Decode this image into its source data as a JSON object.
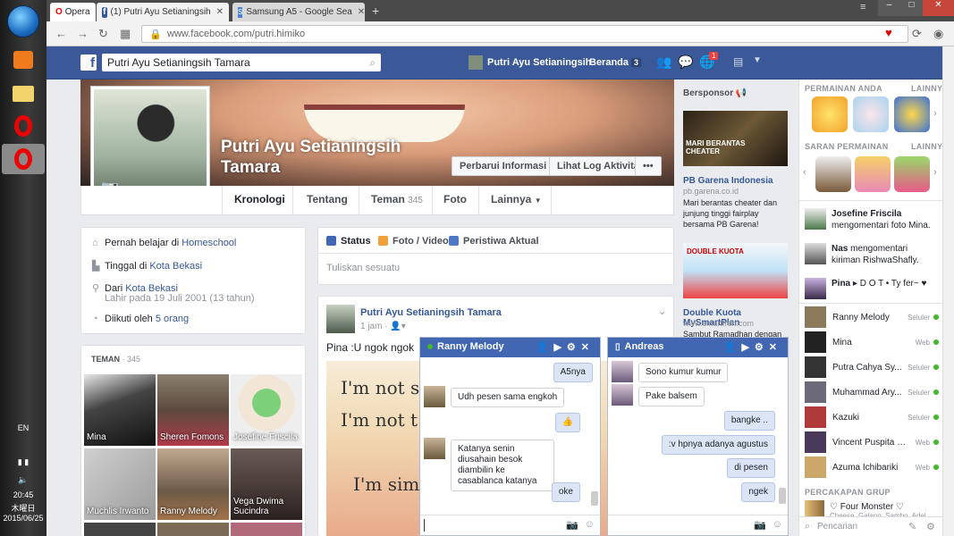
{
  "taskbar": {
    "lang": "EN",
    "time": "20:45",
    "day": "木曜日",
    "date": "2015/06/25"
  },
  "browser": {
    "opera_label": "Opera",
    "tabs": [
      {
        "label": "(1) Putri Ayu Setianingsih"
      },
      {
        "label": "Samsung A5 - Google Sea"
      }
    ],
    "url": "www.facebook.com/putri.himiko"
  },
  "fb_header": {
    "search_value": "Putri Ayu Setianingsih Tamara",
    "profile_name": "Putri Ayu Setianingsih",
    "home_label": "Beranda",
    "home_count": "3",
    "notif_count": "1"
  },
  "profile": {
    "name_line1": "Putri Ayu Setianingsih",
    "name_line2": "Tamara",
    "update_info": "Perbarui Informasi",
    "activity_log": "Lihat Log Aktivitas",
    "more": "•••",
    "tabs": {
      "timeline": "Kronologi",
      "about": "Tentang",
      "friends": "Teman",
      "friends_count": "345",
      "photos": "Foto",
      "more": "Lainnya"
    }
  },
  "intro": {
    "studied_prefix": "Pernah belajar di ",
    "studied_link": "Homeschool",
    "lives_prefix": "Tinggal di ",
    "lives_link": "Kota Bekasi",
    "from_prefix": "Dari ",
    "from_link": "Kota Bekasi",
    "born": "Lahir pada 19 Juli 2001 (13 tahun)",
    "followed_prefix": "Diikuti oleh ",
    "followed_link": "5 orang"
  },
  "friends_box": {
    "title": "TEMAN",
    "sep": " · ",
    "count": "345",
    "tiles": [
      "Mina",
      "Sheren Fomons",
      "Josefine Friscila",
      "Muchlis Irwanto",
      "Ranny Melody",
      "Vega Dwima Sucindra"
    ]
  },
  "composer": {
    "status": "Status",
    "photo_video": "Foto / Video",
    "life_event": "Peristiwa Aktual",
    "placeholder": "Tuliskan sesuatu"
  },
  "post": {
    "author": "Putri Ayu Setianingsih Tamara",
    "time": "1 jam · ",
    "audience_icon": "friends-icon",
    "text": "Pina :U ngok ngok",
    "image_line1": "I'm not s",
    "image_line2": "I'm not t",
    "image_line3": "I'm simp"
  },
  "ads": {
    "heading": "Bersponsor",
    "ad1": {
      "banner_text": "MARI BERANTAS CHEATER",
      "title": "PB Garena Indonesia",
      "url": "pb.garena.co.id",
      "body": "Mari berantas cheater dan junjung tinggi fairplay bersama PB Garena!"
    },
    "ad2": {
      "banner_text": "DOUBLE KUOTA",
      "title": "Double Kuota MySmartPlan",
      "url": "www.smartfren.com",
      "body": "Sambut Ramadhan dengan"
    }
  },
  "chat_sidebar": {
    "games_heading": "PERMAINAN ANDA",
    "games_more": "LAINNYA",
    "suggest_heading": "SARAN PERMAINAN",
    "suggest_more": "LAINNYA",
    "activity": [
      {
        "name": "Josefine Friscila",
        "text": " mengomentari foto Mina."
      },
      {
        "name": "Nas",
        "text": " mengomentari kiriman RishwaShafly."
      },
      {
        "name": "Pina",
        "text": " ▸ D O T •  Ty fer~ ♥"
      }
    ],
    "contacts": [
      {
        "name": "Ranny Melody",
        "status": "Seluler"
      },
      {
        "name": "Mina",
        "status": "Web"
      },
      {
        "name": "Putra Cahya Sy...",
        "status": "Seluler"
      },
      {
        "name": "Muhammad Ary...",
        "status": "Seluler"
      },
      {
        "name": "Kazuki",
        "status": "Seluler"
      },
      {
        "name": "Vincent Puspita Sari",
        "status": "Web"
      },
      {
        "name": "Azuma Ichibariki",
        "status": "Web"
      }
    ],
    "group_heading": "PERCAKAPAN GRUP",
    "group_name": "♡ Four Monster ♡",
    "group_sub": "Cheese, Galang, Sambo, Adel",
    "search_placeholder": "Pencarian"
  },
  "chat1": {
    "name": "Ranny Melody",
    "messages": {
      "m1": "A5nya",
      "m2": "Udh pesen sama engkoh",
      "m3": "👍",
      "m4": "Katanya senin diusahain besok diambilin ke casablanca katanya",
      "m5": "oke"
    }
  },
  "chat2": {
    "name": "Andreas",
    "messages": {
      "m1": "Sono kumur kumur",
      "m2": "Pake balsem",
      "m3": "bangke ..",
      "m4": ":v hpnya adanya agustus",
      "m5": "di pesen",
      "m6": "ngek"
    }
  }
}
